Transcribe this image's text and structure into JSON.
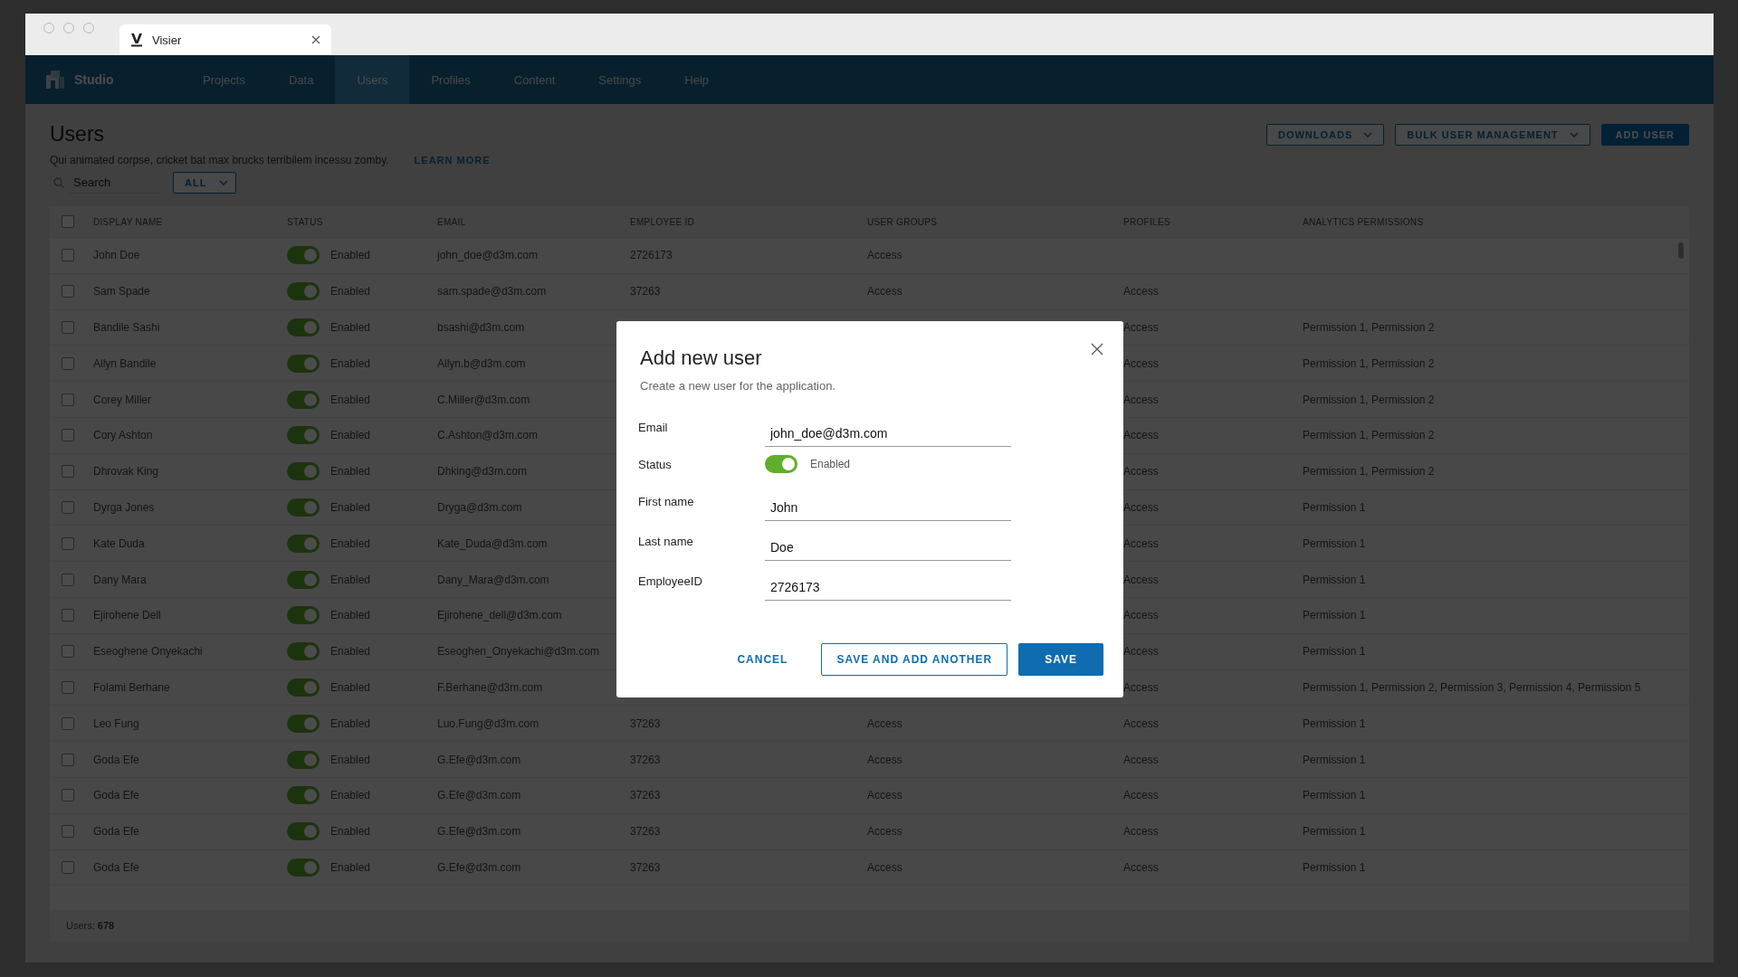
{
  "browser_tab": {
    "title": "Visier"
  },
  "nav": {
    "brand": "Studio",
    "items": [
      {
        "label": "Projects",
        "selected": false
      },
      {
        "label": "Data",
        "selected": false
      },
      {
        "label": "Users",
        "selected": true
      },
      {
        "label": "Profiles",
        "selected": false
      },
      {
        "label": "Content",
        "selected": false
      },
      {
        "label": "Settings",
        "selected": false
      },
      {
        "label": "Help",
        "selected": false
      }
    ]
  },
  "page": {
    "title": "Users",
    "description": "Qui animated corpse, cricket bat max brucks terribilem incessu zomby.",
    "learn_more": "LEARN MORE",
    "search": {
      "placeholder": "Search"
    },
    "filter": {
      "value": "ALL"
    },
    "actions": [
      {
        "label": "DOWNLOADS",
        "kind": "dropdown"
      },
      {
        "label": "BULK USER MANAGEMENT",
        "kind": "dropdown"
      },
      {
        "label": "ADD USER",
        "kind": "primary"
      }
    ]
  },
  "table": {
    "all_checked": false,
    "columns": [
      "DISPLAY NAME",
      "STATUS",
      "EMAIL",
      "EMPLOYEE ID",
      "USER GROUPS",
      "PROFILES",
      "ANALYTICS PERMISSIONS"
    ],
    "rows": [
      {
        "checked": false,
        "name": "John Doe",
        "status_on": true,
        "status": "Enabled",
        "email": "john_doe@d3m.com",
        "employee_id": "2726173",
        "user_groups": "Access"
      },
      {
        "checked": false,
        "name": "Sam Spade",
        "status_on": true,
        "status": "Enabled",
        "email": "sam.spade@d3m.com",
        "employee_id": "37263",
        "user_groups": "Access",
        "profiles": "Access"
      },
      {
        "checked": false,
        "name": "Bandile Sashi",
        "status_on": true,
        "status": "Enabled",
        "email": "bsashi@d3m.com",
        "profiles": "Access",
        "analytics": "Permission 1, Permission 2"
      },
      {
        "checked": false,
        "name": "Allyn Bandile",
        "status_on": true,
        "status": "Enabled",
        "email": "Allyn.b@d3m.com",
        "profiles": "Access",
        "analytics": "Permission 1, Permission 2"
      },
      {
        "checked": false,
        "name": "Corey Miller",
        "status_on": true,
        "status": "Enabled",
        "email": "C.Miller@d3m.com",
        "profiles": "Access",
        "analytics": "Permission 1, Permission 2"
      },
      {
        "checked": false,
        "name": "Cory Ashton",
        "status_on": true,
        "status": "Enabled",
        "email": "C.Ashton@d3m.com",
        "profiles": "Access",
        "analytics": "Permission 1, Permission 2"
      },
      {
        "checked": false,
        "name": "Dhrovak King",
        "status_on": true,
        "status": "Enabled",
        "email": "Dhking@d3m.com",
        "profiles": "Access",
        "analytics": "Permission 1, Permission 2"
      },
      {
        "checked": false,
        "name": "Dyrga Jones",
        "status_on": true,
        "status": "Enabled",
        "email": "Dryga@d3m.com",
        "profiles": "Access",
        "analytics": "Permission 1"
      },
      {
        "checked": false,
        "name": "Kate Duda",
        "status_on": true,
        "status": "Enabled",
        "email": "Kate_Duda@d3m.com",
        "profiles": "Access",
        "analytics": "Permission 1"
      },
      {
        "checked": false,
        "name": "Dany Mara",
        "status_on": true,
        "status": "Enabled",
        "email": "Dany_Mara@d3m.com",
        "profiles": "Access",
        "analytics": "Permission 1"
      },
      {
        "checked": false,
        "name": "Ejirohene Dell",
        "status_on": true,
        "status": "Enabled",
        "email": "Ejirohene_dell@d3m.com",
        "profiles": "Access",
        "analytics": "Permission 1"
      },
      {
        "checked": false,
        "name": "Eseoghene Onyekachi",
        "status_on": true,
        "status": "Enabled",
        "email": "Eseoghen_Onyekachi@d3m.com",
        "profiles": "Access",
        "analytics": "Permission 1"
      },
      {
        "checked": false,
        "name": "Folami Berhane",
        "status_on": true,
        "status": "Enabled",
        "email": "F.Berhane@d3m.com",
        "profiles": "Access",
        "analytics": "Permission 1, Permission 2, Permission 3, Permission 4, Permission 5"
      },
      {
        "checked": false,
        "name": "Leo Fung",
        "status_on": true,
        "status": "Enabled",
        "email": "Luo.Fung@d3m.com",
        "employee_id": "37263",
        "user_groups": "Access",
        "profiles": "Access",
        "analytics": "Permission 1"
      },
      {
        "checked": false,
        "name": "Goda Efe",
        "status_on": true,
        "status": "Enabled",
        "email": "G.Efe@d3m.com",
        "employee_id": "37263",
        "user_groups": "Access",
        "profiles": "Access",
        "analytics": "Permission 1"
      },
      {
        "checked": false,
        "name": "Goda Efe",
        "status_on": true,
        "status": "Enabled",
        "email": "G.Efe@d3m.com",
        "employee_id": "37263",
        "user_groups": "Access",
        "profiles": "Access",
        "analytics": "Permission 1"
      },
      {
        "checked": false,
        "name": "Goda Efe",
        "status_on": true,
        "status": "Enabled",
        "email": "G.Efe@d3m.com",
        "employee_id": "37263",
        "user_groups": "Access",
        "profiles": "Access",
        "analytics": "Permission 1"
      },
      {
        "checked": false,
        "name": "Goda Efe",
        "status_on": true,
        "status": "Enabled",
        "email": "G.Efe@d3m.com",
        "employee_id": "37263",
        "user_groups": "Access",
        "profiles": "Access",
        "analytics": "Permission 1"
      }
    ],
    "footer": "Users: **678**"
  },
  "dialog": {
    "title": "Add new user",
    "subtitle": "Create a new user for the application.",
    "fields": [
      {
        "label": "Email",
        "kind": "text",
        "value": "john_doe@d3m.com"
      },
      {
        "label": "Status",
        "kind": "toggle",
        "on": true,
        "text": "Enabled"
      },
      {
        "label": "First name",
        "kind": "text",
        "value": "John"
      },
      {
        "label": "Last name",
        "kind": "text",
        "value": "Doe"
      },
      {
        "label": "EmployeeID",
        "kind": "text",
        "value": "2726173"
      }
    ],
    "buttons": [
      {
        "label": "CANCEL",
        "kind": "text"
      },
      {
        "label": "SAVE AND ADD ANOTHER",
        "kind": "outline"
      },
      {
        "label": "SAVE",
        "kind": "primary"
      }
    ]
  }
}
